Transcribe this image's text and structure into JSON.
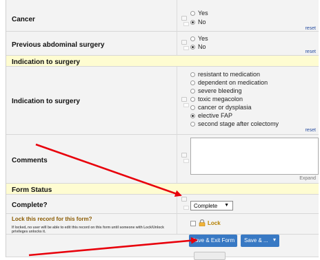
{
  "fields": {
    "cancer": {
      "label": "Cancer",
      "options": [
        {
          "text": "Yes",
          "selected": false
        },
        {
          "text": "No",
          "selected": true
        }
      ],
      "reset": "reset"
    },
    "previous_surgery": {
      "label": "Previous abdominal surgery",
      "options": [
        {
          "text": "Yes",
          "selected": false
        },
        {
          "text": "No",
          "selected": true
        }
      ],
      "reset": "reset"
    },
    "indication_section": {
      "label": "Indication to surgery"
    },
    "indication": {
      "label": "Indication to surgery",
      "options": [
        {
          "text": "resistant to medication",
          "selected": false
        },
        {
          "text": "dependent on medication",
          "selected": false
        },
        {
          "text": "severe bleeding",
          "selected": false
        },
        {
          "text": "toxic megacolon",
          "selected": false
        },
        {
          "text": "cancer or dysplasia",
          "selected": false
        },
        {
          "text": "elective FAP",
          "selected": true
        },
        {
          "text": "second stage after colectomy",
          "selected": false
        }
      ],
      "reset": "reset"
    },
    "comments": {
      "label": "Comments",
      "expand": "Expand"
    },
    "form_status": {
      "label": "Form Status"
    },
    "complete": {
      "label": "Complete?",
      "value": "Complete",
      "caret": "▼"
    },
    "lock": {
      "title": "Lock this record for this form?",
      "note": "If locked, no user will be able to edit this record on this form until someone with Lock/Unlock privileges unlocks it.",
      "checkbox_label": "Lock"
    }
  },
  "buttons": {
    "save_exit": "Save & Exit Form",
    "save_more": "Save & ...",
    "save_more_caret": "▾"
  },
  "colors": {
    "section_header": "#fefcd1",
    "row_bg": "#f3f3f3",
    "primary_button": "#3879c4",
    "annotation_arrow": "#e8000b",
    "reset_link": "#2a4fa0"
  }
}
